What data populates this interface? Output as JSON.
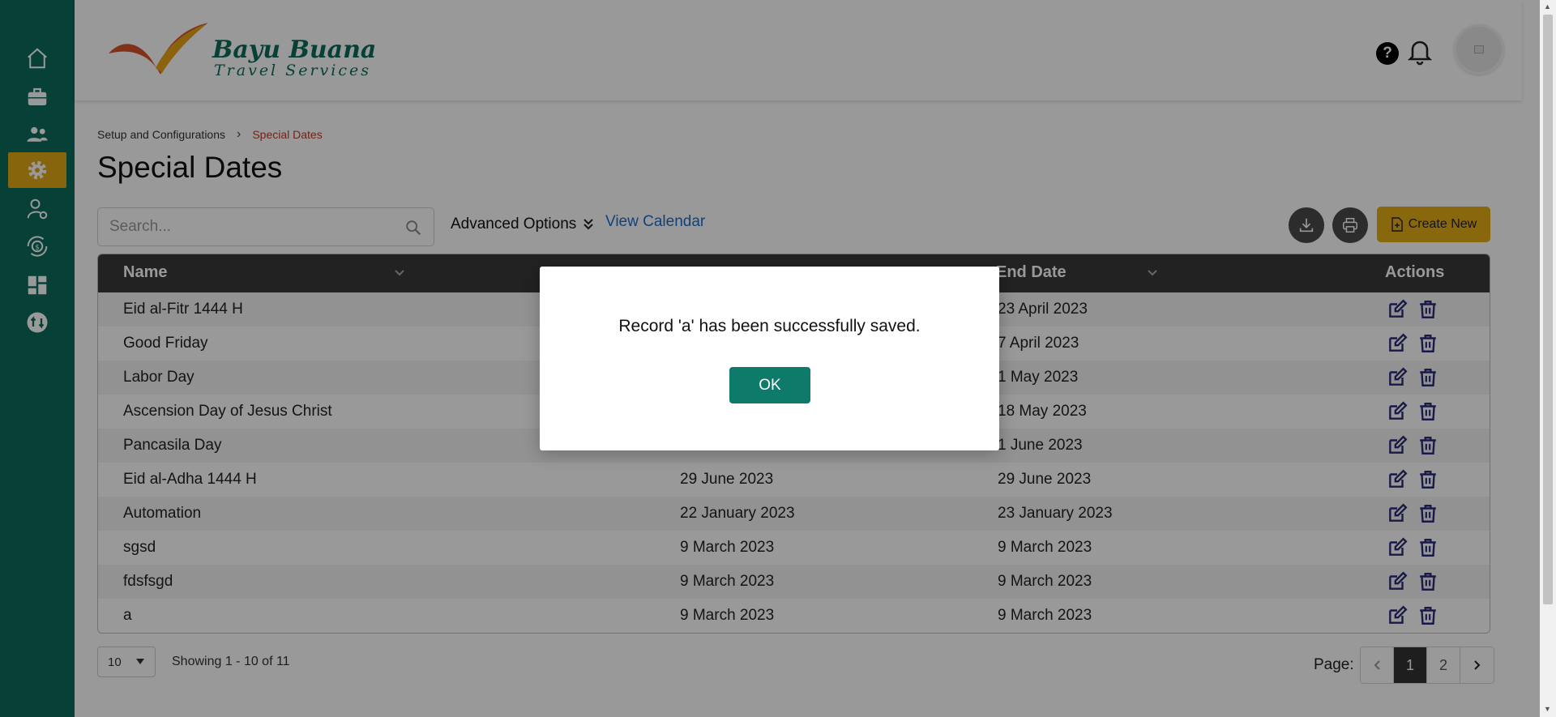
{
  "sidebar": {
    "items": [
      {
        "icon": "home-icon"
      },
      {
        "icon": "briefcase-icon"
      },
      {
        "icon": "users-icon"
      },
      {
        "icon": "gear-icon",
        "active": true
      },
      {
        "icon": "user-settings-icon"
      },
      {
        "icon": "money-cycle-icon"
      },
      {
        "icon": "dashboard-icon"
      },
      {
        "icon": "exchange-icon"
      }
    ]
  },
  "header": {
    "logo_line1": "Bayu Buana",
    "logo_line2": "Travel Services",
    "help_label": "?"
  },
  "breadcrumb": {
    "parent": "Setup and Configurations",
    "current": "Special Dates"
  },
  "page": {
    "title": "Special Dates"
  },
  "toolbar": {
    "search_placeholder": "Search...",
    "advanced_options": "Advanced Options",
    "view_calendar": "View Calendar",
    "create_new": "Create New"
  },
  "table": {
    "headers": {
      "name": "Name",
      "end_date": "End Date",
      "actions": "Actions"
    },
    "rows": [
      {
        "name": "Eid al-Fitr 1444 H",
        "start": "",
        "end": "23 April 2023"
      },
      {
        "name": "Good Friday",
        "start": "",
        "end": "7 April 2023"
      },
      {
        "name": "Labor Day",
        "start": "",
        "end": "1 May 2023"
      },
      {
        "name": "Ascension Day of Jesus Christ",
        "start": "",
        "end": "18 May 2023"
      },
      {
        "name": "Pancasila Day",
        "start": "",
        "end": "1 June 2023"
      },
      {
        "name": "Eid al-Adha 1444 H",
        "start": "29 June 2023",
        "end": "29 June 2023"
      },
      {
        "name": "Automation",
        "start": "22 January 2023",
        "end": "23 January 2023"
      },
      {
        "name": "sgsd",
        "start": "9 March 2023",
        "end": "9 March 2023"
      },
      {
        "name": "fdsfsgd",
        "start": "9 March 2023",
        "end": "9 March 2023"
      },
      {
        "name": "a",
        "start": "9 March 2023",
        "end": "9 March 2023"
      }
    ]
  },
  "footer": {
    "page_size": "10",
    "showing": "Showing 1 - 10 of 11",
    "page_label": "Page:",
    "pages": [
      "1",
      "2"
    ],
    "current_page": "1"
  },
  "modal": {
    "message": "Record 'a' has been successfully saved.",
    "ok_label": "OK"
  },
  "colors": {
    "sidebar": "#0a6b5c",
    "accent": "#e0a814",
    "table_header": "#3a3a3a",
    "action_icon": "#2b2a7a",
    "ok_button": "#0e7a6a"
  }
}
